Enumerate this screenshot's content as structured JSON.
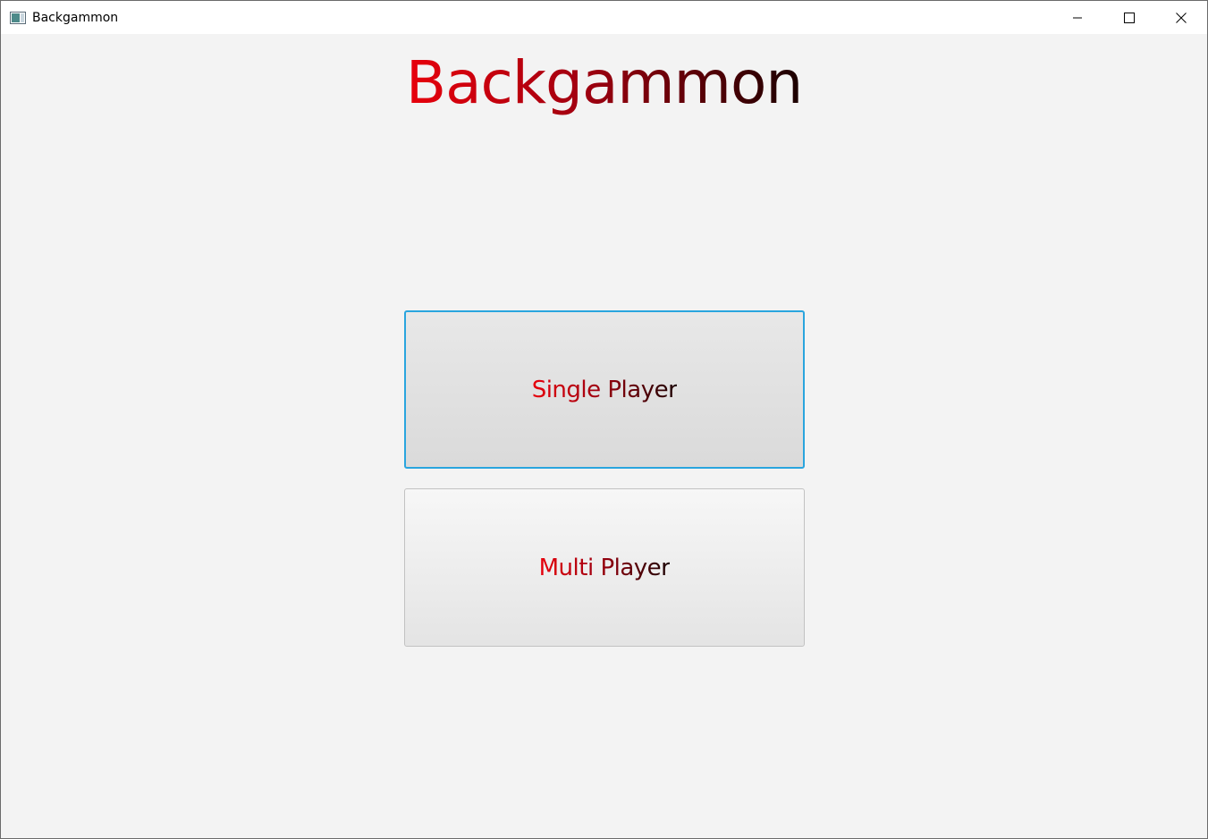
{
  "window": {
    "title": "Backgammon",
    "icon": "app-window-icon",
    "controls": {
      "minimize_icon": "minimize-icon",
      "maximize_icon": "maximize-icon",
      "close_icon": "close-icon"
    }
  },
  "main": {
    "heading": "Backgammon",
    "heading_gradient": [
      "#e8000c",
      "#a00010",
      "#1a0000"
    ],
    "buttons": [
      {
        "label": "Single Player",
        "focused": true
      },
      {
        "label": "Multi Player",
        "focused": false
      }
    ]
  },
  "colors": {
    "focus_border": "#2aa5de",
    "background": "#f3f3f3"
  }
}
